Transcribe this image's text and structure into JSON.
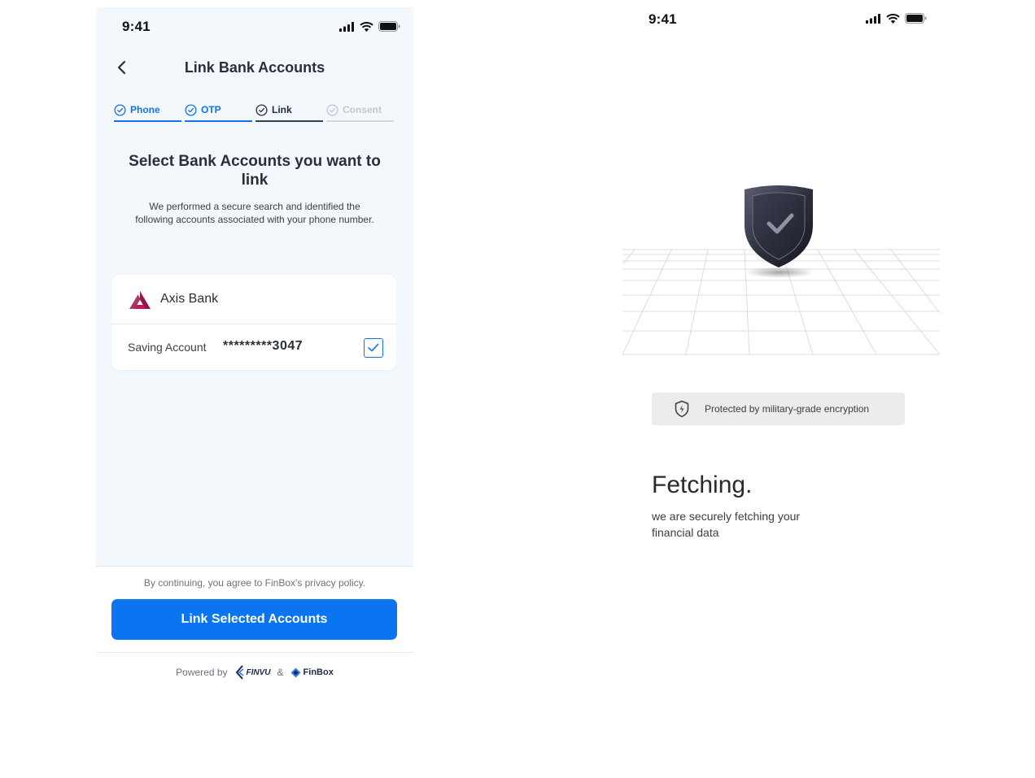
{
  "left_screen": {
    "status": {
      "time": "9:41"
    },
    "header": {
      "title": "Link Bank Accounts",
      "back_icon": "chevron-left-icon"
    },
    "steps": [
      {
        "label": "Phone",
        "state": "done"
      },
      {
        "label": "OTP",
        "state": "done"
      },
      {
        "label": "Link",
        "state": "current"
      },
      {
        "label": "Consent",
        "state": "todo"
      }
    ],
    "section": {
      "title": "Select Bank Accounts you want to link",
      "description": "We performed a secure search and identified the following accounts associated with your phone number."
    },
    "bank": {
      "name": "Axis Bank",
      "logo_color": "#97144d",
      "account": {
        "type": "Saving Account",
        "number": "*********3047",
        "selected": true
      }
    },
    "footer": {
      "consent": "By continuing, you agree to FinBox's privacy policy.",
      "button": "Link Selected Accounts",
      "powered_by": "Powered by",
      "brand_one": "FINVU",
      "separator": "&",
      "brand_two": "FinBox"
    }
  },
  "right_screen": {
    "status": {
      "time": "9:41"
    },
    "encryption_badge": "Protected by military-grade encryption",
    "title": "Fetching.",
    "description": "we are securely fetching your financial data"
  },
  "colors": {
    "primary": "#0a74f1",
    "step_done": "#1273e8",
    "screen_bg": "#f3f8fd"
  }
}
